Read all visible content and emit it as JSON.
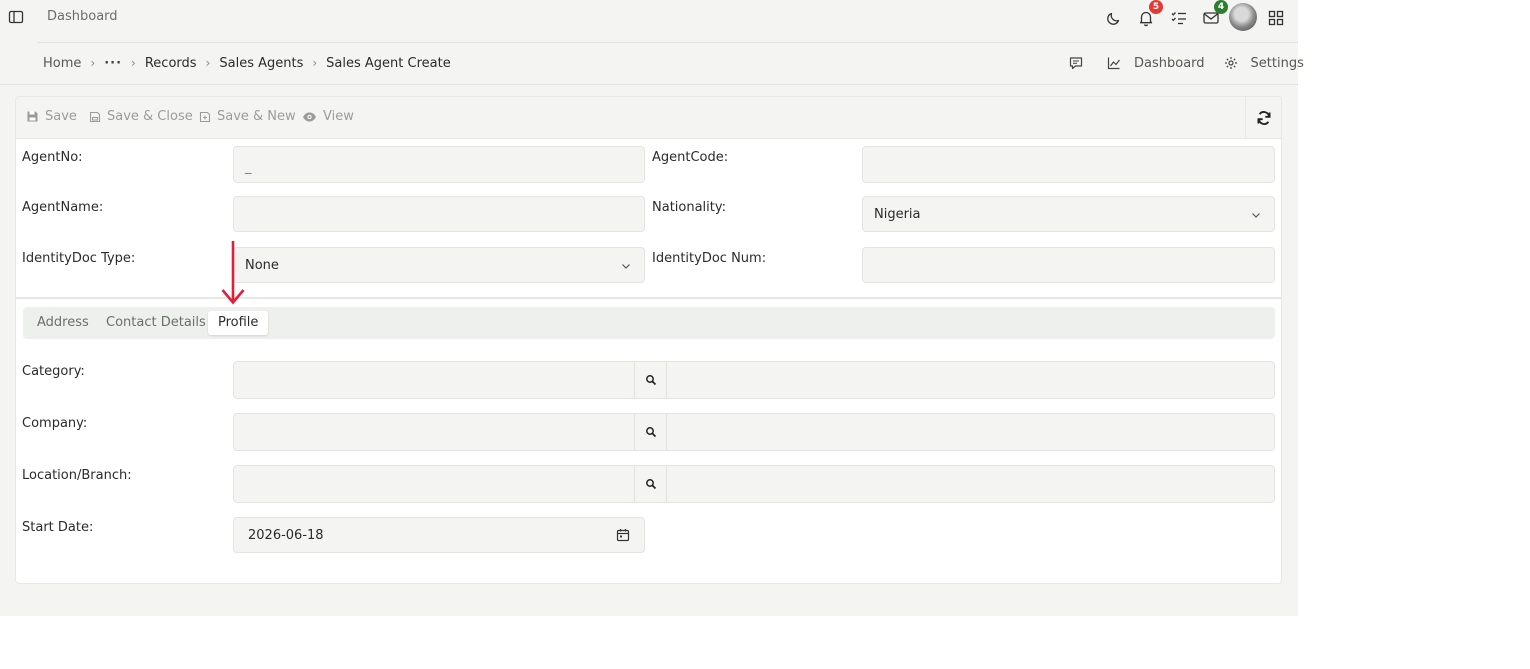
{
  "topbar": {
    "title": "Dashboard",
    "notifications_count": "5",
    "mail_count": "4",
    "icons": [
      "sidebar-toggle-icon",
      "moon-icon",
      "bell-icon",
      "tasks-icon",
      "mail-icon",
      "avatar",
      "apps-grid-icon"
    ]
  },
  "breadcrumb": {
    "home": "Home",
    "ellipsis": "···",
    "items": [
      "Records",
      "Sales Agents"
    ],
    "current": "Sales Agent Create",
    "right": {
      "dashboard": "Dashboard",
      "settings": "Settings"
    }
  },
  "toolbar": {
    "save": "Save",
    "save_close": "Save & Close",
    "save_new": "Save & New",
    "view": "View"
  },
  "form": {
    "agent_no": {
      "label": "AgentNo:",
      "value": "_"
    },
    "agent_code": {
      "label": "AgentCode:",
      "value": ""
    },
    "agent_name": {
      "label": "AgentName:",
      "value": ""
    },
    "nationality": {
      "label": "Nationality:",
      "value": "Nigeria"
    },
    "identity_doc_type": {
      "label": "IdentityDoc Type:",
      "value": "None"
    },
    "identity_doc_num": {
      "label": "IdentityDoc Num:",
      "value": ""
    }
  },
  "tabs": [
    {
      "label": "Address",
      "active": false
    },
    {
      "label": "Contact Details",
      "active": false
    },
    {
      "label": "Profile",
      "active": true
    }
  ],
  "profile": {
    "category": {
      "label": "Category:",
      "value": "",
      "description": ""
    },
    "company": {
      "label": "Company:",
      "value": "",
      "description": ""
    },
    "location": {
      "label": "Location/Branch:",
      "value": "",
      "description": ""
    },
    "start_date": {
      "label": "Start Date:",
      "value": "2026-06-18"
    }
  },
  "colors": {
    "annotation_arrow": "#e0203a",
    "badge_red": "#e53935",
    "badge_green": "#2e7d32",
    "page_background": "#f4f5f3"
  }
}
